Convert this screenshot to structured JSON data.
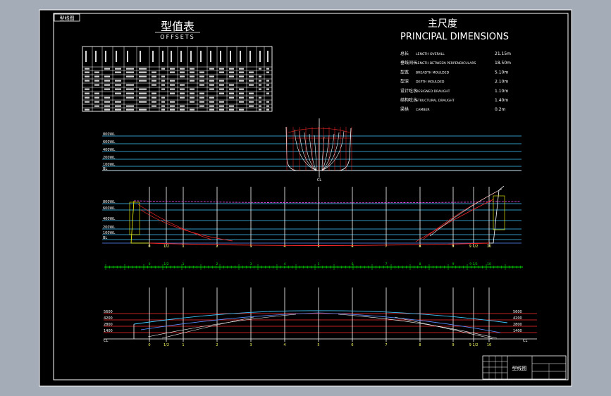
{
  "colors": {
    "background": "#a4acb8",
    "paper": "#000000",
    "line_white": "#ffffff",
    "line_cyan": "#3fc8ff",
    "line_blue": "#5a8cff",
    "line_red": "#ff2a2a",
    "line_green": "#00e000",
    "line_magenta": "#ff55ff",
    "text_yellow": "#ffff66"
  },
  "stamp_tl": "型线图",
  "offsets": {
    "title_cn": "型值表",
    "title_en": "OFFSETS"
  },
  "principal": {
    "title_cn": "主尺度",
    "title_en": "PRINCIPAL DIMENSIONS",
    "rows": [
      {
        "cn": "总长",
        "en": "LENGTH OVERALL",
        "value": "21.15m"
      },
      {
        "cn": "垂线间长",
        "en": "LENGTH BETWEEN PERPENDICULARS",
        "value": "18.50m"
      },
      {
        "cn": "型宽",
        "en": "BREADTH MOULDED",
        "value": "5.10m"
      },
      {
        "cn": "型深",
        "en": "DEPTH MOULDED",
        "value": "2.10m"
      },
      {
        "cn": "设计吃水",
        "en": "DESIGNED DRAUGHT",
        "value": "1.10m"
      },
      {
        "cn": "结构吃水",
        "en": "STRUCTURAL DRAUGHT",
        "value": "1.40m"
      },
      {
        "cn": "梁拱",
        "en": "CAMBER",
        "value": "0.2m"
      }
    ]
  },
  "body_plan": {
    "levels": [
      "800WL",
      "600WL",
      "400WL",
      "200WL",
      "100WL",
      "BL"
    ],
    "center_mark": "CL"
  },
  "profile": {
    "levels": [
      "800WL",
      "600WL",
      "400WL",
      "200WL",
      "100WL",
      "BL"
    ],
    "stations": [
      "0",
      "1/2",
      "1",
      "2",
      "3",
      "4",
      "5",
      "6",
      "7",
      "8",
      "9",
      "9 1/2",
      "10"
    ]
  },
  "half_breadth": {
    "levels": [
      "5600",
      "4200",
      "2800",
      "1400"
    ],
    "base": "CL",
    "stations": [
      "0",
      "1/2",
      "1",
      "2",
      "3",
      "4",
      "5",
      "6",
      "7",
      "8",
      "9",
      "9 1/2",
      "10"
    ]
  },
  "title_block": {
    "drawing_title": "型线图"
  }
}
